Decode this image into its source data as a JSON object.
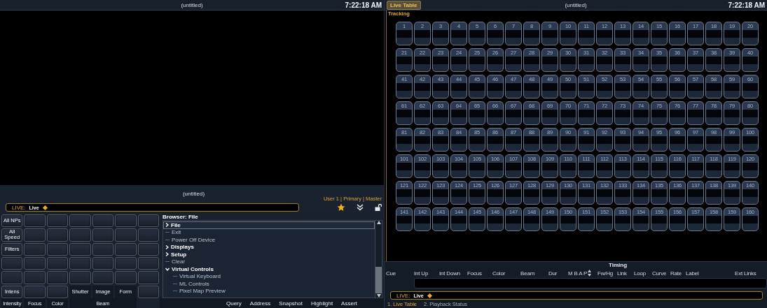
{
  "left": {
    "title_bar": {
      "title": "(untitled)",
      "time": "7:22:18 AM"
    },
    "lower_panel": {
      "title": "(untitled)",
      "user_info": "User 1  |  Primary  |  Master",
      "command_line": {
        "prefix": "LIVE:",
        "text": "Live"
      },
      "softkeys": [
        [
          {
            "kind": "key",
            "label": "All NPs"
          },
          {
            "kind": "key"
          },
          {
            "kind": "key"
          },
          {
            "kind": "key"
          },
          {
            "kind": "key"
          },
          {
            "kind": "key"
          },
          {
            "kind": "key"
          }
        ],
        [
          {
            "kind": "key",
            "label": "All Speed"
          },
          {
            "kind": "key"
          },
          {
            "kind": "key"
          },
          {
            "kind": "key"
          },
          {
            "kind": "key"
          },
          {
            "kind": "key"
          },
          {
            "kind": "key"
          }
        ],
        [
          {
            "kind": "key",
            "label": "Filters"
          },
          {
            "kind": "key"
          },
          {
            "kind": "key"
          },
          {
            "kind": "key"
          },
          {
            "kind": "key"
          },
          {
            "kind": "key"
          },
          {
            "kind": "key"
          }
        ],
        [
          {
            "kind": "key"
          },
          {
            "kind": "key"
          },
          {
            "kind": "key"
          },
          {
            "kind": "key"
          },
          {
            "kind": "key"
          },
          {
            "kind": "key"
          },
          {
            "kind": "key"
          }
        ],
        [
          {
            "kind": "key"
          },
          {
            "kind": "key"
          },
          {
            "kind": "key"
          },
          {
            "kind": "key"
          },
          {
            "kind": "key"
          },
          {
            "kind": "key"
          },
          {
            "kind": "key"
          }
        ],
        [
          {
            "kind": "key",
            "label": "Intens"
          },
          {
            "kind": "key"
          },
          {
            "kind": "key"
          },
          {
            "kind": "flat",
            "label": "Shutter"
          },
          {
            "kind": "flat",
            "label": "Image"
          },
          {
            "kind": "flat",
            "label": "Form"
          },
          {
            "kind": "key"
          }
        ]
      ],
      "categories": [
        {
          "label": "Intensity"
        },
        {
          "label": "Focus"
        },
        {
          "label": "Color"
        },
        {
          "label": "Beam"
        }
      ],
      "browser": {
        "title": "Browser: File",
        "items": [
          {
            "label": "File",
            "kind": "folder",
            "expanded": false,
            "selected": true
          },
          {
            "label": "Exit",
            "kind": "command",
            "selected": false
          },
          {
            "label": "Power Off Device",
            "kind": "command",
            "selected": false
          },
          {
            "label": "Displays",
            "kind": "folder",
            "expanded": false,
            "selected": false
          },
          {
            "label": "Setup",
            "kind": "folder",
            "expanded": false,
            "selected": false
          },
          {
            "label": "Clear",
            "kind": "command",
            "selected": false
          },
          {
            "label": "Virtual Controls",
            "kind": "folder",
            "expanded": true,
            "selected": false,
            "children": [
              {
                "label": "Virtual Keyboard",
                "kind": "command",
                "selected": false
              },
              {
                "label": "ML Controls",
                "kind": "command",
                "selected": false
              },
              {
                "label": "Pixel Map Preview",
                "kind": "command",
                "selected": false
              }
            ]
          }
        ]
      },
      "actions": [
        "Query",
        "Address",
        "Snapshot",
        "Highlight",
        "Assert"
      ]
    }
  },
  "right": {
    "title_bar": {
      "tab": {
        "label": "Live Table",
        "selected": true
      },
      "title": "(untitled)",
      "time": "7:22:18 AM"
    },
    "mode": "Tracking",
    "channels": [
      "1",
      "2",
      "3",
      "4",
      "5",
      "6",
      "7",
      "8",
      "9",
      "10",
      "11",
      "12",
      "13",
      "14",
      "15",
      "16",
      "17",
      "18",
      "19",
      "20",
      "21",
      "22",
      "23",
      "24",
      "25",
      "26",
      "27",
      "28",
      "29",
      "30",
      "31",
      "32",
      "33",
      "34",
      "35",
      "36",
      "37",
      "38",
      "39",
      "40",
      "41",
      "42",
      "43",
      "44",
      "45",
      "46",
      "47",
      "48",
      "49",
      "50",
      "51",
      "52",
      "53",
      "54",
      "55",
      "56",
      "57",
      "58",
      "59",
      "60",
      "61",
      "62",
      "63",
      "64",
      "65",
      "66",
      "67",
      "68",
      "69",
      "70",
      "71",
      "72",
      "73",
      "74",
      "75",
      "76",
      "77",
      "78",
      "79",
      "80",
      "81",
      "82",
      "83",
      "84",
      "85",
      "86",
      "87",
      "88",
      "89",
      "90",
      "91",
      "92",
      "93",
      "94",
      "95",
      "96",
      "97",
      "98",
      "99",
      "100",
      "101",
      "102",
      "103",
      "104",
      "105",
      "106",
      "107",
      "108",
      "109",
      "110",
      "111",
      "112",
      "113",
      "114",
      "115",
      "116",
      "117",
      "118",
      "119",
      "120",
      "121",
      "122",
      "123",
      "124",
      "125",
      "126",
      "127",
      "128",
      "129",
      "130",
      "131",
      "132",
      "133",
      "134",
      "135",
      "136",
      "137",
      "138",
      "139",
      "140",
      "141",
      "142",
      "143",
      "144",
      "145",
      "146",
      "147",
      "148",
      "149",
      "150",
      "151",
      "152",
      "153",
      "154",
      "155",
      "156",
      "157",
      "158",
      "159",
      "160"
    ],
    "timing": {
      "title": "Timing",
      "columns": [
        {
          "kind": "text",
          "label": "Cue"
        },
        {
          "kind": "text",
          "label": "Int Up"
        },
        {
          "kind": "text",
          "label": "Int Down"
        },
        {
          "kind": "text",
          "label": "Focus"
        },
        {
          "kind": "text",
          "label": "Color"
        },
        {
          "kind": "text",
          "label": "Beam"
        },
        {
          "kind": "text",
          "label": "Dur"
        },
        {
          "kind": "text",
          "label": "M B A P"
        },
        {
          "kind": "sort"
        },
        {
          "kind": "text",
          "label": "Fw/Hg"
        },
        {
          "kind": "text",
          "label": "Link"
        },
        {
          "kind": "text",
          "label": "Loop"
        },
        {
          "kind": "text",
          "label": "Curve"
        },
        {
          "kind": "text",
          "label": "Rate"
        },
        {
          "kind": "text",
          "label": "Label"
        },
        {
          "kind": "text",
          "label": "Ext Links"
        }
      ]
    },
    "command_line": {
      "prefix": "LIVE:",
      "text": "Live"
    },
    "tabs": [
      {
        "label": "1. Live Table",
        "selected": true
      },
      {
        "label": "2. Playback Status",
        "selected": false
      }
    ]
  }
}
